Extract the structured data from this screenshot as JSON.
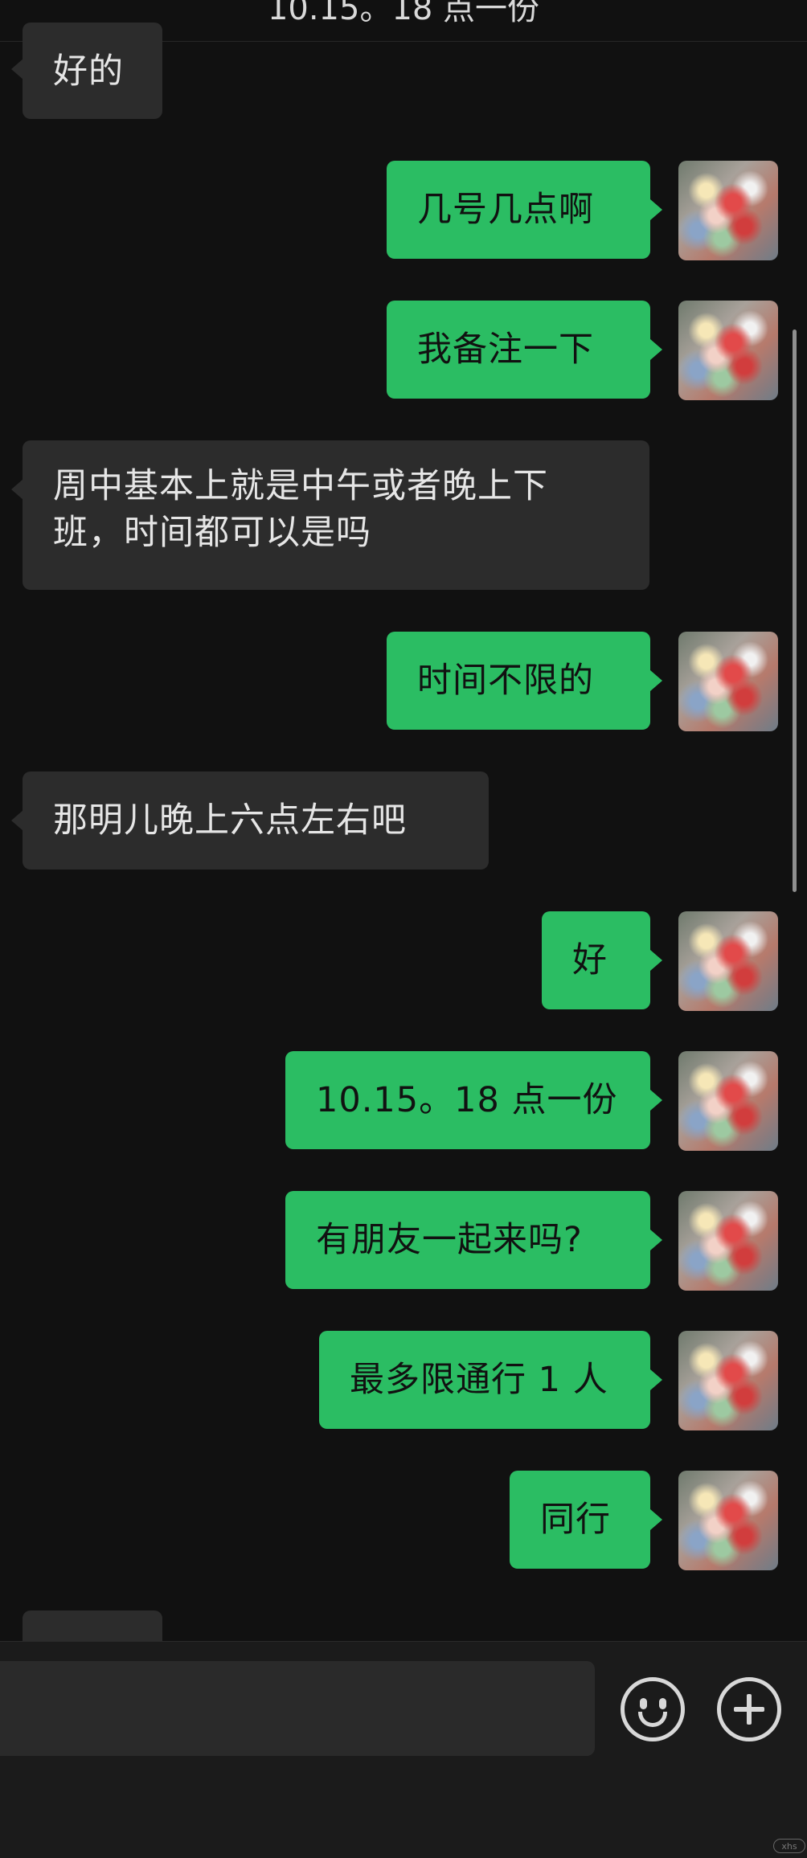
{
  "header": {
    "title": "10.15。18 点一份"
  },
  "messages": [
    {
      "side": "in",
      "text": "好的"
    },
    {
      "side": "out",
      "text": "几号几点啊"
    },
    {
      "side": "out",
      "text": "我备注一下"
    },
    {
      "side": "in",
      "text": "周中基本上就是中午或者晚上下\n班，时间都可以是吗"
    },
    {
      "side": "out",
      "text": "时间不限的"
    },
    {
      "side": "in",
      "text": "那明儿晚上六点左右吧"
    },
    {
      "side": "out",
      "text": "好"
    },
    {
      "side": "out",
      "text": "10.15。18 点一份"
    },
    {
      "side": "out",
      "text": "有朋友一起来吗?"
    },
    {
      "side": "out",
      "text": "最多限通行 1 人"
    },
    {
      "side": "out",
      "text": "同行"
    },
    {
      "side": "in",
      "text": ""
    }
  ],
  "input_bar": {
    "emoji_icon": "smiley-face-icon",
    "plus_icon": "plus-circle-icon"
  },
  "watermark": "xhs",
  "colors": {
    "background": "#111111",
    "incoming_bubble": "#2c2c2c",
    "outgoing_bubble": "#2bbd63",
    "outgoing_text": "#111111",
    "incoming_text": "#e6e6e6"
  }
}
